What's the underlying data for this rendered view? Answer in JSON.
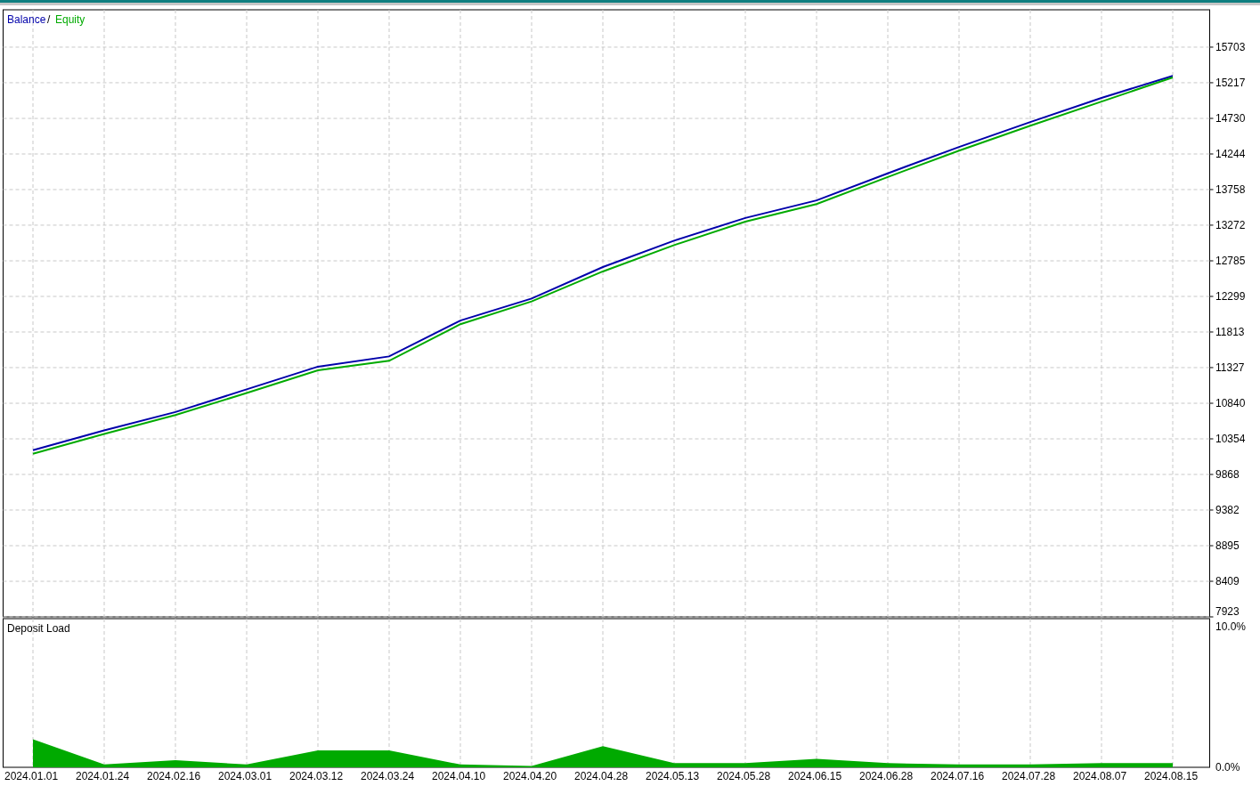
{
  "balance_equity": {
    "legend_separator": "/",
    "chart_data": {
      "type": "line",
      "grid": true,
      "ylim": [
        7923,
        16213
      ],
      "yticks": [
        15703,
        15217,
        14730,
        14244,
        13758,
        13272,
        12785,
        12299,
        11813,
        11327,
        10840,
        10354,
        9868,
        9382,
        8895,
        8409,
        7923
      ],
      "series": [
        {
          "name": "Balance",
          "color": "#0000aa",
          "values": [
            10200,
            10470,
            10720,
            11030,
            11340,
            11480,
            11970,
            12270,
            12700,
            13060,
            13370,
            13610,
            13980,
            14340,
            14680,
            15010,
            15310
          ]
        },
        {
          "name": "Equity",
          "color": "#00aa00",
          "values": [
            10150,
            10420,
            10680,
            10980,
            11290,
            11420,
            11920,
            12230,
            12640,
            13000,
            13320,
            13560,
            13930,
            14290,
            14630,
            14960,
            15290
          ]
        }
      ]
    }
  },
  "deposit_load": {
    "chart_data": {
      "type": "area",
      "grid": true,
      "ylim": [
        0,
        10.6
      ],
      "yticks": [
        {
          "value": 10,
          "label": "10.0%"
        },
        {
          "value": 0,
          "label": "0.0%"
        }
      ],
      "categories": [
        "2024.01.01",
        "2024.01.24",
        "2024.02.16",
        "2024.03.01",
        "2024.03.12",
        "2024.03.24",
        "2024.04.10",
        "2024.04.20",
        "2024.04.28",
        "2024.05.13",
        "2024.05.28",
        "2024.06.15",
        "2024.06.28",
        "2024.07.16",
        "2024.07.28",
        "2024.08.07",
        "2024.08.15"
      ],
      "series": [
        {
          "name": "Deposit Load",
          "color": "#00aa00",
          "values": [
            2.0,
            0.2,
            0.5,
            0.2,
            1.2,
            1.2,
            0.2,
            0.1,
            1.5,
            0.3,
            0.3,
            0.6,
            0.3,
            0.2,
            0.2,
            0.3,
            0.3
          ]
        }
      ]
    }
  }
}
